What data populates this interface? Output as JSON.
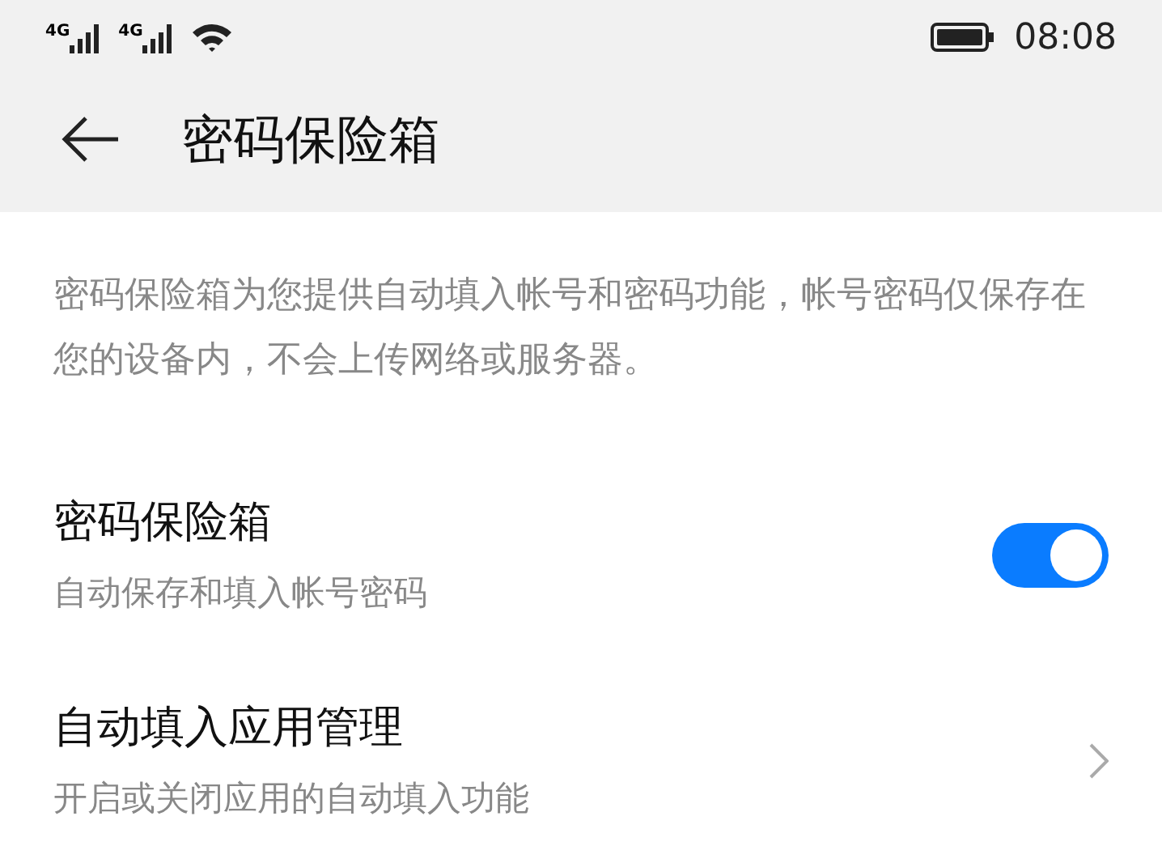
{
  "status_bar": {
    "signals": [
      {
        "label": "4G"
      },
      {
        "label": "4G"
      }
    ],
    "time": "08:08"
  },
  "header": {
    "title": "密码保险箱"
  },
  "description": "密码保险箱为您提供自动填入帐号和密码功能，帐号密码仅保存在您的设备内，不会上传网络或服务器。",
  "settings": [
    {
      "kind": "toggle",
      "title": "密码保险箱",
      "subtitle": "自动保存和填入帐号密码",
      "on": true
    },
    {
      "kind": "link",
      "title": "自动填入应用管理",
      "subtitle": "开启或关闭应用的自动填入功能"
    }
  ]
}
